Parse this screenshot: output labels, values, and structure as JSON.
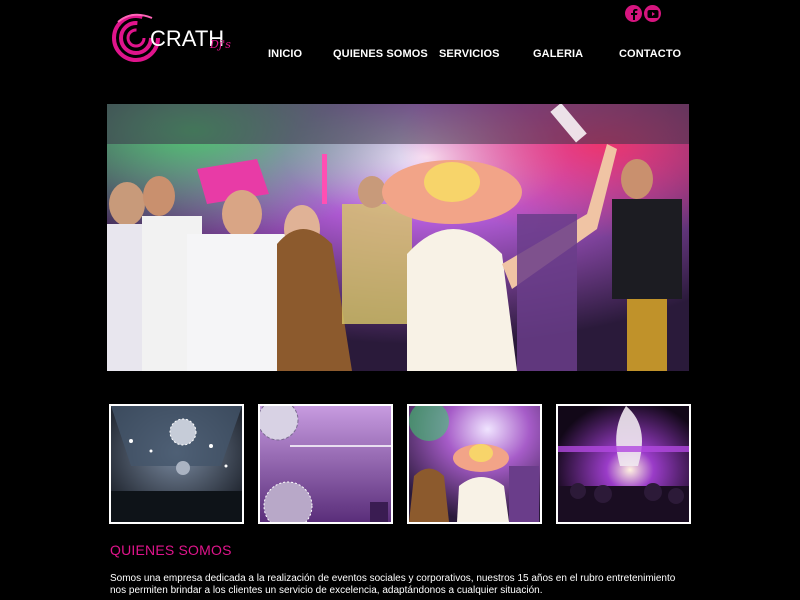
{
  "brand": {
    "name": "CRATH",
    "suffix": "Dj's",
    "accent_color": "#e0148c"
  },
  "social": [
    {
      "icon": "facebook-icon",
      "glyph": "f"
    },
    {
      "icon": "youtube-icon",
      "glyph": "▶"
    }
  ],
  "nav": {
    "items": [
      "INICIO",
      "QUIENES SOMOS",
      "SERVICIOS",
      "GALERIA",
      "CONTACTO"
    ]
  },
  "hero": {
    "subject": "party-photo"
  },
  "gallery": {
    "thumbnails": [
      "disco-ball-hall",
      "purple-disco-ball",
      "party-dancers",
      "night-venue-lights"
    ]
  },
  "about": {
    "title": "QUIENES SOMOS",
    "text": "Somos una empresa dedicada a la realización de eventos sociales y corporativos, nuestros 15 años en el rubro entretenimiento nos permiten brindar a los clientes un servicio de excelencia, adaptándonos a cualquier situación."
  }
}
